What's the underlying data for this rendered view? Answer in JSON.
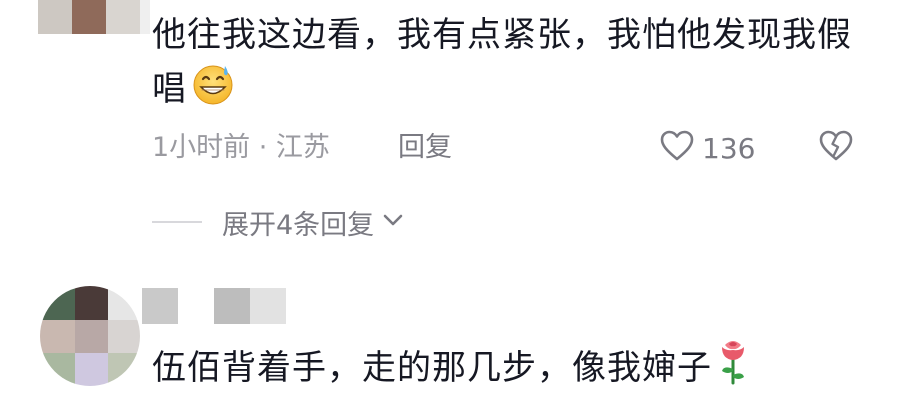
{
  "comments": [
    {
      "text": "他往我这边看，我有点紧张，我怕他发现我假唱",
      "emoji": "grinning-sweat-emoji",
      "meta": "1小时前 · 江苏",
      "reply_label": "回复",
      "like_count": "136",
      "expand_label": "展开4条回复"
    },
    {
      "text": "伍佰背着手，走的那几步，像我婶子",
      "emoji": "rose-emoji"
    }
  ],
  "colors": {
    "text_primary": "#161823",
    "text_secondary": "#9a9aa0",
    "background": "#ffffff"
  }
}
